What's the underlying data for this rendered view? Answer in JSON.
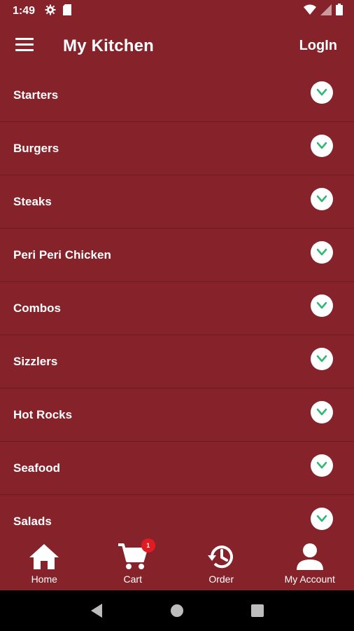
{
  "status": {
    "time": "1:49"
  },
  "header": {
    "title": "My Kitchen",
    "login_label": "LogIn"
  },
  "menu": {
    "items": [
      {
        "label": "Starters"
      },
      {
        "label": "Burgers"
      },
      {
        "label": "Steaks"
      },
      {
        "label": "Peri Peri Chicken"
      },
      {
        "label": "Combos"
      },
      {
        "label": "Sizzlers"
      },
      {
        "label": "Hot Rocks"
      },
      {
        "label": "Seafood"
      },
      {
        "label": "Salads"
      }
    ]
  },
  "bottom_nav": {
    "home": "Home",
    "cart": "Cart",
    "cart_badge": "1",
    "order": "Order",
    "account": "My Account"
  },
  "colors": {
    "background": "#86222a",
    "chevron": "#2eb872",
    "badge": "#e01b22"
  }
}
